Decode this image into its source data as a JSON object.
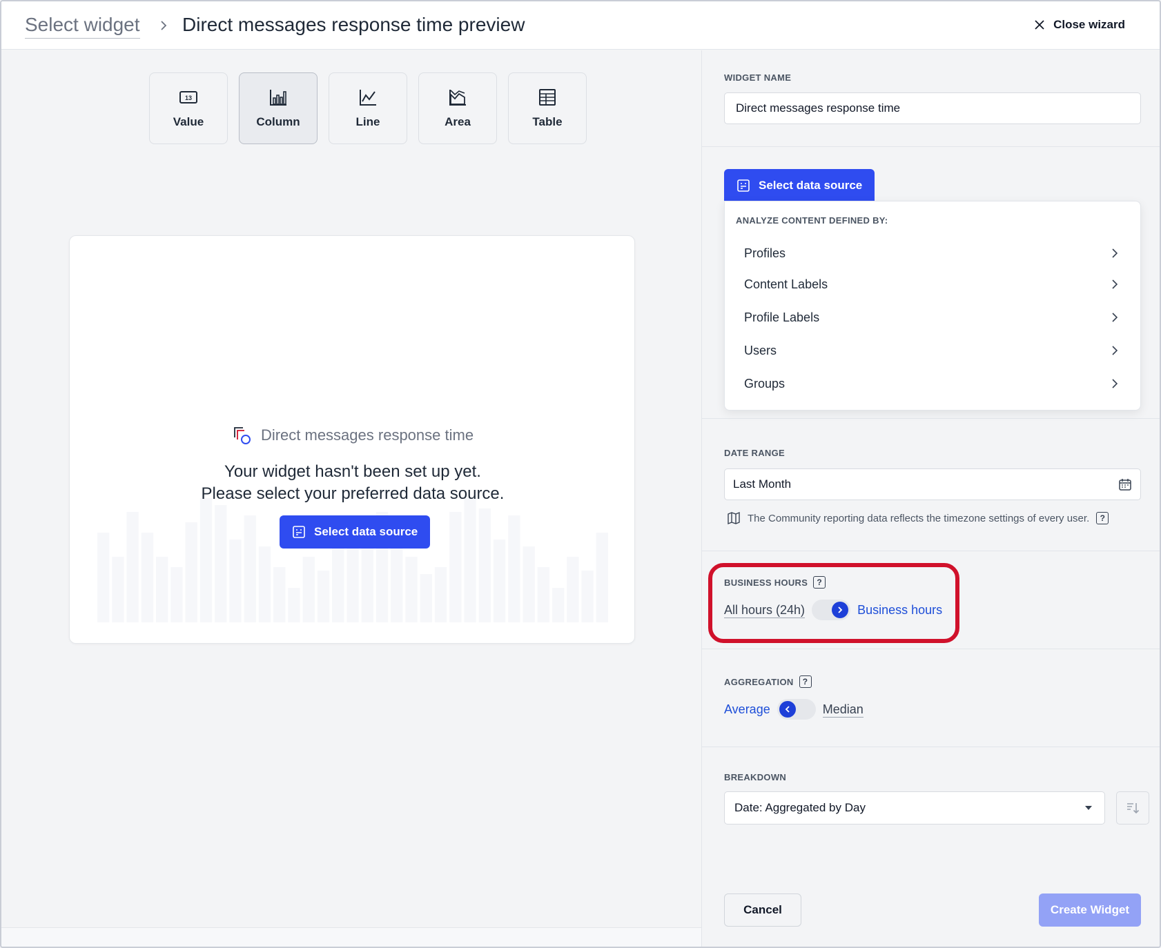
{
  "header": {
    "breadcrumb_link": "Select widget",
    "title": "Direct messages response time preview",
    "close_label": "Close wizard"
  },
  "widget_types": [
    {
      "label": "Value",
      "icon": "value-icon",
      "glyph": "13",
      "active": false
    },
    {
      "label": "Column",
      "icon": "column-chart-icon",
      "active": true
    },
    {
      "label": "Line",
      "icon": "line-chart-icon",
      "active": false
    },
    {
      "label": "Area",
      "icon": "area-chart-icon",
      "active": false
    },
    {
      "label": "Table",
      "icon": "table-icon",
      "active": false
    }
  ],
  "preview": {
    "widget_title": "Direct messages response time",
    "empty_message": "Your widget hasn't been set up yet. Please select your preferred data source.",
    "select_source_label": "Select data source"
  },
  "form": {
    "widget_name": {
      "label": "WIDGET NAME",
      "value": "Direct messages response time"
    },
    "data_source": {
      "button_label": "Select data source",
      "dropdown_heading": "ANALYZE CONTENT DEFINED BY:",
      "items": [
        "Profiles",
        "Content Labels",
        "Profile Labels",
        "Users",
        "Groups"
      ]
    },
    "date_range": {
      "label": "DATE RANGE",
      "value": "Last Month",
      "note": "The Community reporting data reflects the timezone settings of every user."
    },
    "business_hours": {
      "label": "BUSINESS HOURS",
      "left_option": "All hours (24h)",
      "right_option": "Business hours",
      "selected": "right"
    },
    "aggregation": {
      "label": "AGGREGATION",
      "left_option": "Average",
      "right_option": "Median",
      "selected": "left"
    },
    "breakdown": {
      "label": "BREAKDOWN",
      "value": "Date: Aggregated by Day"
    },
    "cancel_label": "Cancel",
    "create_label": "Create Widget"
  },
  "colors": {
    "primary": "#2f4cf0",
    "toggle_knob": "#1d3fd8",
    "highlight": "#d0112b",
    "create_disabled": "#93a2f6"
  }
}
